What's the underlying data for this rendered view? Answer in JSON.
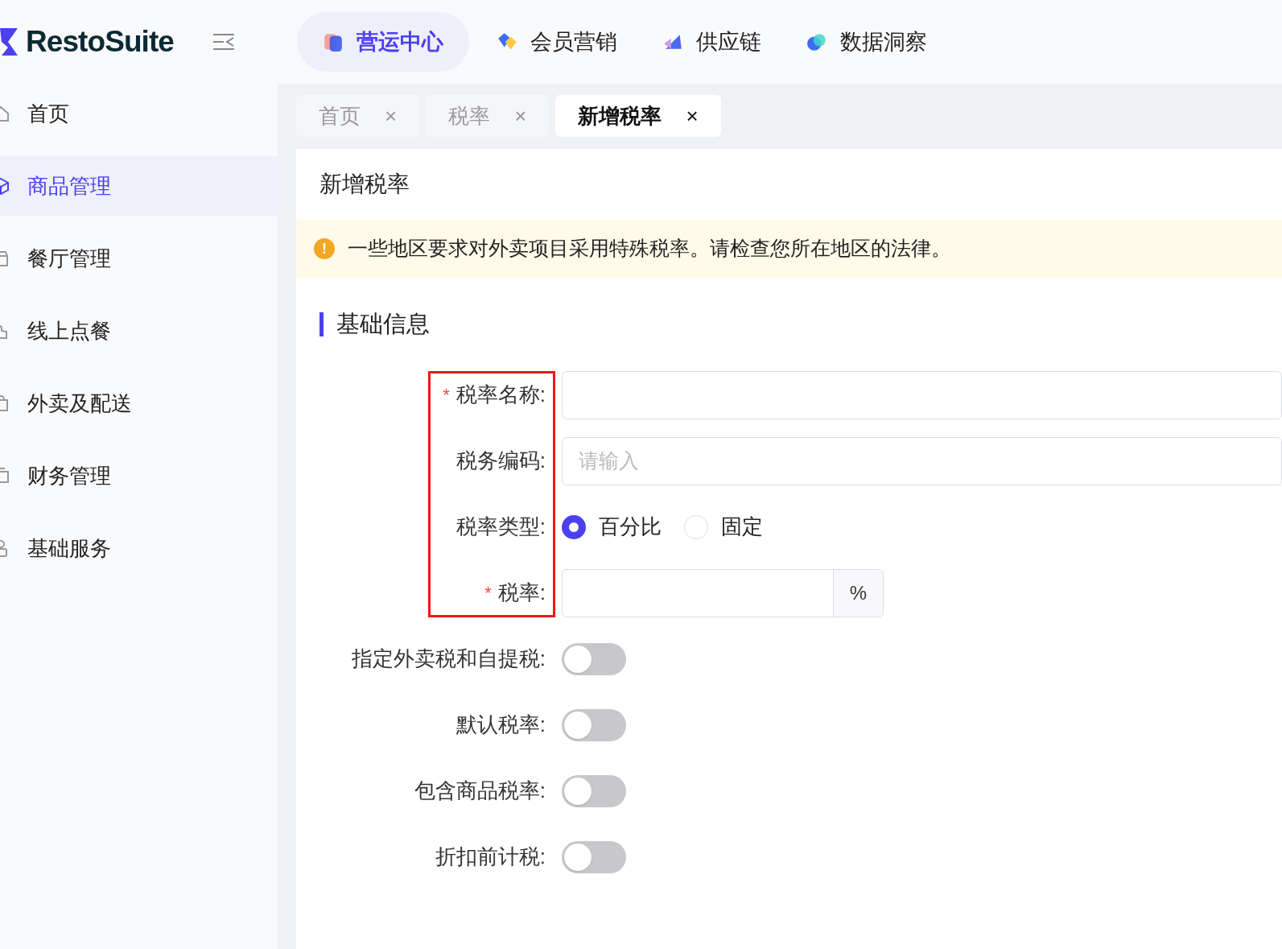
{
  "brand": {
    "name": "RestoSuite"
  },
  "top_nav": [
    {
      "label": "营运中心",
      "selected": true
    },
    {
      "label": "会员营销",
      "selected": false
    },
    {
      "label": "供应链",
      "selected": false
    },
    {
      "label": "数据洞察",
      "selected": false
    }
  ],
  "sidebar": {
    "items": [
      {
        "label": "首页",
        "selected": false
      },
      {
        "label": "商品管理",
        "selected": true
      },
      {
        "label": "餐厅管理",
        "selected": false
      },
      {
        "label": "线上点餐",
        "selected": false
      },
      {
        "label": "外卖及配送",
        "selected": false
      },
      {
        "label": "财务管理",
        "selected": false
      },
      {
        "label": "基础服务",
        "selected": false
      }
    ]
  },
  "tabs": [
    {
      "label": "首页",
      "close": "×",
      "selected": false
    },
    {
      "label": "税率",
      "close": "×",
      "selected": false
    },
    {
      "label": "新增税率",
      "close": "×",
      "selected": true
    }
  ],
  "page": {
    "title": "新增税率",
    "alert": {
      "icon": "!",
      "text": "一些地区要求对外卖项目采用特殊税率。请检查您所在地区的法律。"
    },
    "section_title": "基础信息",
    "field_groups": [
      {
        "framed": true,
        "fields": [
          {
            "kind": "text",
            "required_mark": "*",
            "label": "税率名称:"
          },
          {
            "kind": "text",
            "label": "税务编码:",
            "placeholder": "请输入"
          },
          {
            "kind": "radio",
            "label": "税率类型:",
            "options": [
              {
                "label": "百分比",
                "selected": true
              },
              {
                "label": "固定",
                "selected": false
              }
            ]
          },
          {
            "kind": "suffix",
            "required_mark": "*",
            "label": "税率:",
            "suffix": "%"
          }
        ]
      },
      {
        "framed": false,
        "fields": [
          {
            "kind": "switch",
            "label": "指定外卖税和自提税:",
            "on": false
          },
          {
            "kind": "switch",
            "label": "默认税率:",
            "on": false
          },
          {
            "kind": "switch",
            "label": "包含商品税率:",
            "on": false
          },
          {
            "kind": "switch",
            "label": "折扣前计税:",
            "on": false
          }
        ]
      }
    ]
  }
}
